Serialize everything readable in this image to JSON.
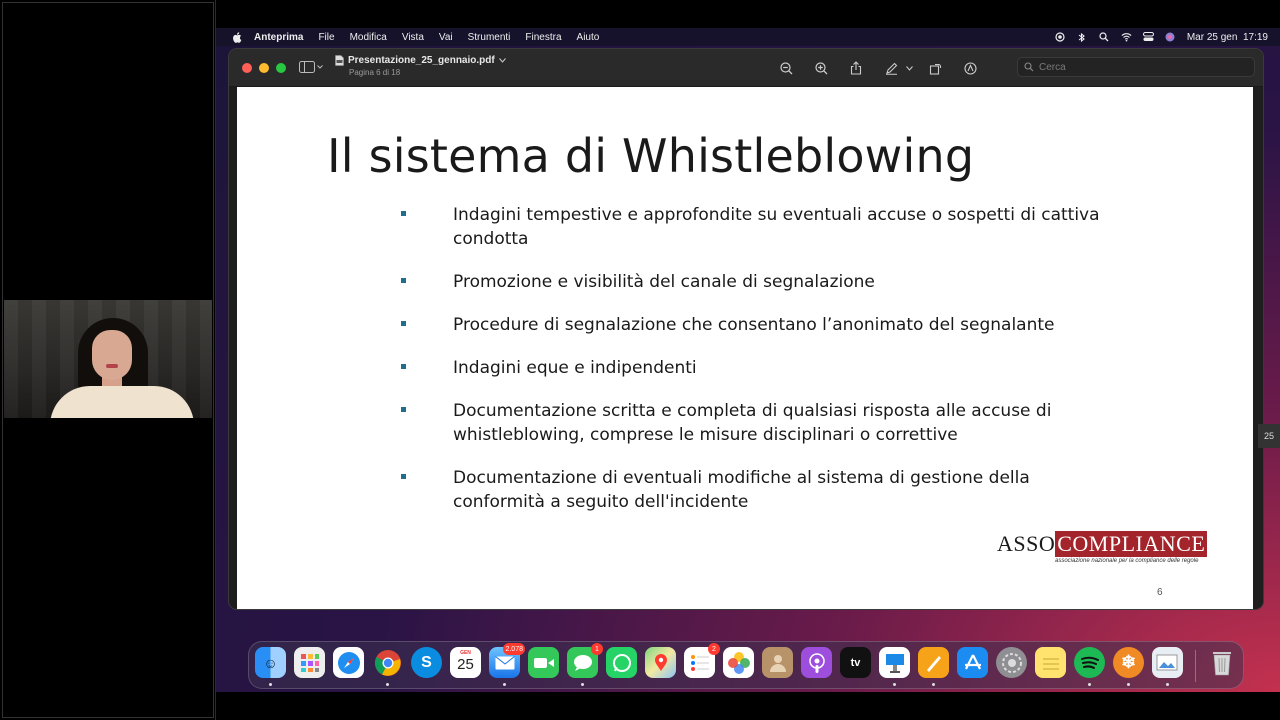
{
  "menubar": {
    "app": "Anteprima",
    "items": [
      "File",
      "Modifica",
      "Vista",
      "Vai",
      "Strumenti",
      "Finestra",
      "Aiuto"
    ],
    "datetime": "Mar 25 gen  17:19"
  },
  "window": {
    "filename": "Presentazione_25_gennaio.pdf",
    "page_info": "Pagina 6 di 18",
    "search_placeholder": "Cerca"
  },
  "slide": {
    "title": "Il sistema di Whistleblowing",
    "bullets": [
      "Indagini tempestive e approfondite su eventuali accuse o sospetti di cattiva condotta",
      "Promozione e visibilità del canale di segnalazione",
      "Procedure di segnalazione che consentano l’anonimato del segnalante",
      "Indagini eque e indipendenti",
      "Documentazione scritta e completa di qualsiasi risposta alle accuse di whistleblowing, comprese le misure disciplinari o correttive",
      "Documentazione di eventuali modifiche al sistema di gestione della conformità a seguito dell'incidente"
    ],
    "logo_left": "ASSO",
    "logo_right": "COMPLIANCE",
    "logo_tagline": "associazione nazionale per la compliance delle regole",
    "page_number": "6"
  },
  "dock": {
    "calendar_month": "GEN",
    "calendar_day": "25",
    "mail_badge": "2.078",
    "messages_badge": "1",
    "reminders_badge": "2",
    "tv_label": "tv"
  },
  "edge_peek": "25",
  "colors": {
    "accent_bullet": "#1f6f8b",
    "logo_red": "#a3242b"
  }
}
